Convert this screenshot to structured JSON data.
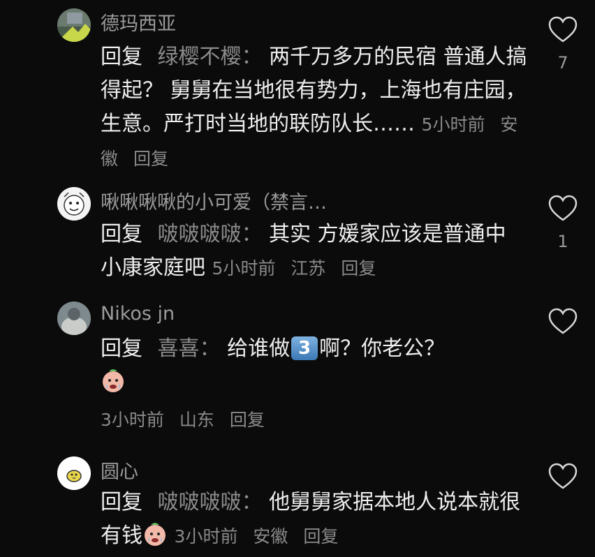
{
  "comments": [
    {
      "username": "德玛西亚",
      "reply_kw": "回复",
      "reply_to": "绿樱不樱：",
      "text": "两千万多万的民宿 普通人搞得起？ 舅舅在当地很有势力，上海也有庄园，生意。严打时当地的联防队长……",
      "time": "5小时前",
      "location": "安徽",
      "reply_action": "回复",
      "likes": "7",
      "avatar_icon": "avatar-photo-icon"
    },
    {
      "username": "啾啾啾啾的小可爱（禁言…",
      "reply_kw": "回复",
      "reply_to": "啵啵啵啵：",
      "text": "其实 方媛家应该是普通中 小康家庭吧",
      "time": "5小时前",
      "location": "江苏",
      "reply_action": "回复",
      "likes": "1",
      "avatar_icon": "avatar-cartoon-icon"
    },
    {
      "username": "Nikos jn",
      "reply_kw": "回复",
      "reply_to": "喜喜：",
      "text_before": "给谁做",
      "badge": "3",
      "text_after": "啊？你老公？",
      "time": "3小时前",
      "location": "山东",
      "reply_action": "回复",
      "likes": "",
      "avatar_icon": "avatar-photo-icon"
    },
    {
      "username": "圆心",
      "reply_kw": "回复",
      "reply_to": "啵啵啵啵：",
      "text": "他舅舅家据本地人说本就很有钱",
      "time": "3小时前",
      "location": "安徽",
      "reply_action": "回复",
      "likes": "",
      "avatar_icon": "avatar-cartoon-icon"
    }
  ],
  "icons": {
    "like": "heart-outline-icon",
    "emoji": "crying-face-emoji-icon"
  },
  "colors": {
    "background": "#0b0b0b",
    "muted": "#8a8a8a"
  }
}
